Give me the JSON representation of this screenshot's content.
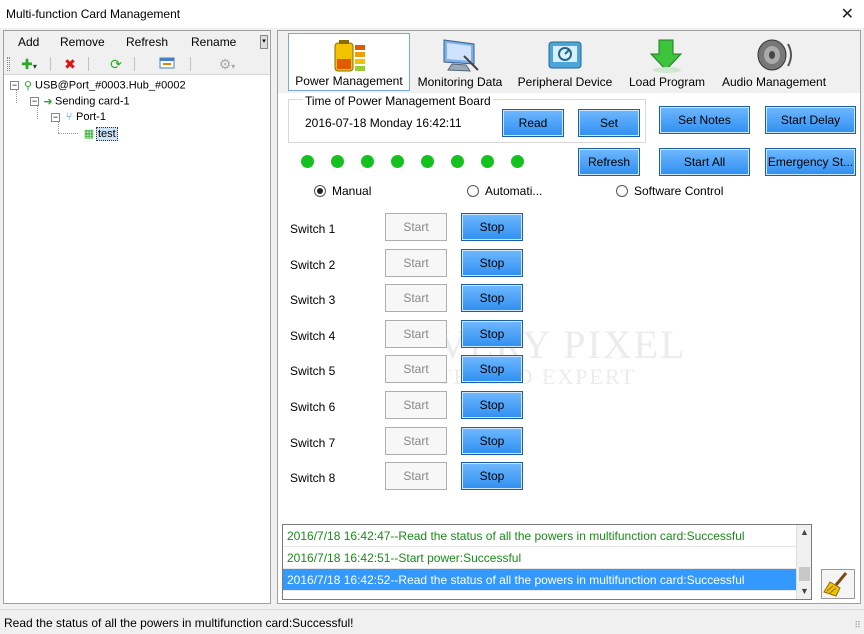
{
  "window": {
    "title": "Multi-function Card Management",
    "close_glyph": "✕"
  },
  "menu": {
    "add": "Add",
    "remove": "Remove",
    "refresh": "Refresh",
    "rename": "Rename"
  },
  "tree": {
    "root": "USB@Port_#0003.Hub_#0002",
    "sending_card": "Sending card-1",
    "port": "Port-1",
    "card": "test"
  },
  "tabs": [
    {
      "label": "Power Management",
      "icon": "battery-icon",
      "active": true
    },
    {
      "label": "Monitoring Data",
      "icon": "monitor-icon",
      "active": false
    },
    {
      "label": "Peripheral Device",
      "icon": "device-icon",
      "active": false
    },
    {
      "label": "Load Program",
      "icon": "download-arrow-icon",
      "active": false
    },
    {
      "label": "Audio Management",
      "icon": "speaker-icon",
      "active": false
    }
  ],
  "power": {
    "time_label": "Time of Power Management Board",
    "time_value": "2016-07-18 Monday 16:42:11",
    "read": "Read",
    "set": "Set",
    "set_notes": "Set Notes",
    "start_delay": "Start Delay",
    "refresh": "Refresh",
    "start_all": "Start All",
    "emergency": "Emergency St...",
    "leds_on": 8,
    "modes": {
      "manual": "Manual",
      "auto": "Automati...",
      "software": "Software Control",
      "selected": "manual"
    },
    "switches": [
      {
        "label": "Switch 1",
        "start": "Start",
        "stop": "Stop"
      },
      {
        "label": "Switch 2",
        "start": "Start",
        "stop": "Stop"
      },
      {
        "label": "Switch 3",
        "start": "Start",
        "stop": "Stop"
      },
      {
        "label": "Switch 4",
        "start": "Start",
        "stop": "Stop"
      },
      {
        "label": "Switch 5",
        "start": "Start",
        "stop": "Stop"
      },
      {
        "label": "Switch 6",
        "start": "Start",
        "stop": "Stop"
      },
      {
        "label": "Switch 7",
        "start": "Start",
        "stop": "Stop"
      },
      {
        "label": "Switch 8",
        "start": "Start",
        "stop": "Stop"
      }
    ]
  },
  "watermark": {
    "line1": "VERY PIXEL",
    "line2": "TEI LED EXPERT"
  },
  "log": [
    "2016/7/18 16:42:47--Read the status of all the powers in multifunction card:Successful",
    "2016/7/18 16:42:51--Start power:Successful",
    "2016/7/18 16:42:52--Read the status of all the powers in multifunction card:Successful"
  ],
  "status": "Read the status of all the powers in multifunction card:Successful!",
  "colors": {
    "accent_blue": "#3399ff",
    "led_green": "#13c21c",
    "log_green": "#1a8a1a",
    "button_blue": "#2f8ff0"
  }
}
